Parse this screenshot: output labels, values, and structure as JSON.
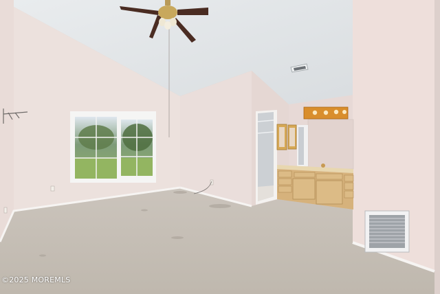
{
  "photo": {
    "watermark": "©2025 MOREMLS"
  },
  "colors": {
    "ceiling": "#e4e7e9",
    "wall": "#ece0dc",
    "wall_shade": "#e2d3ce",
    "carpet": "#c8c2ba",
    "baseboard": "#f4f2f0",
    "cabinet": "#d9ba8a",
    "countertop": "#e8d7b0",
    "light_bar": "#e7a64a",
    "window_view": "#6f9a5c"
  }
}
